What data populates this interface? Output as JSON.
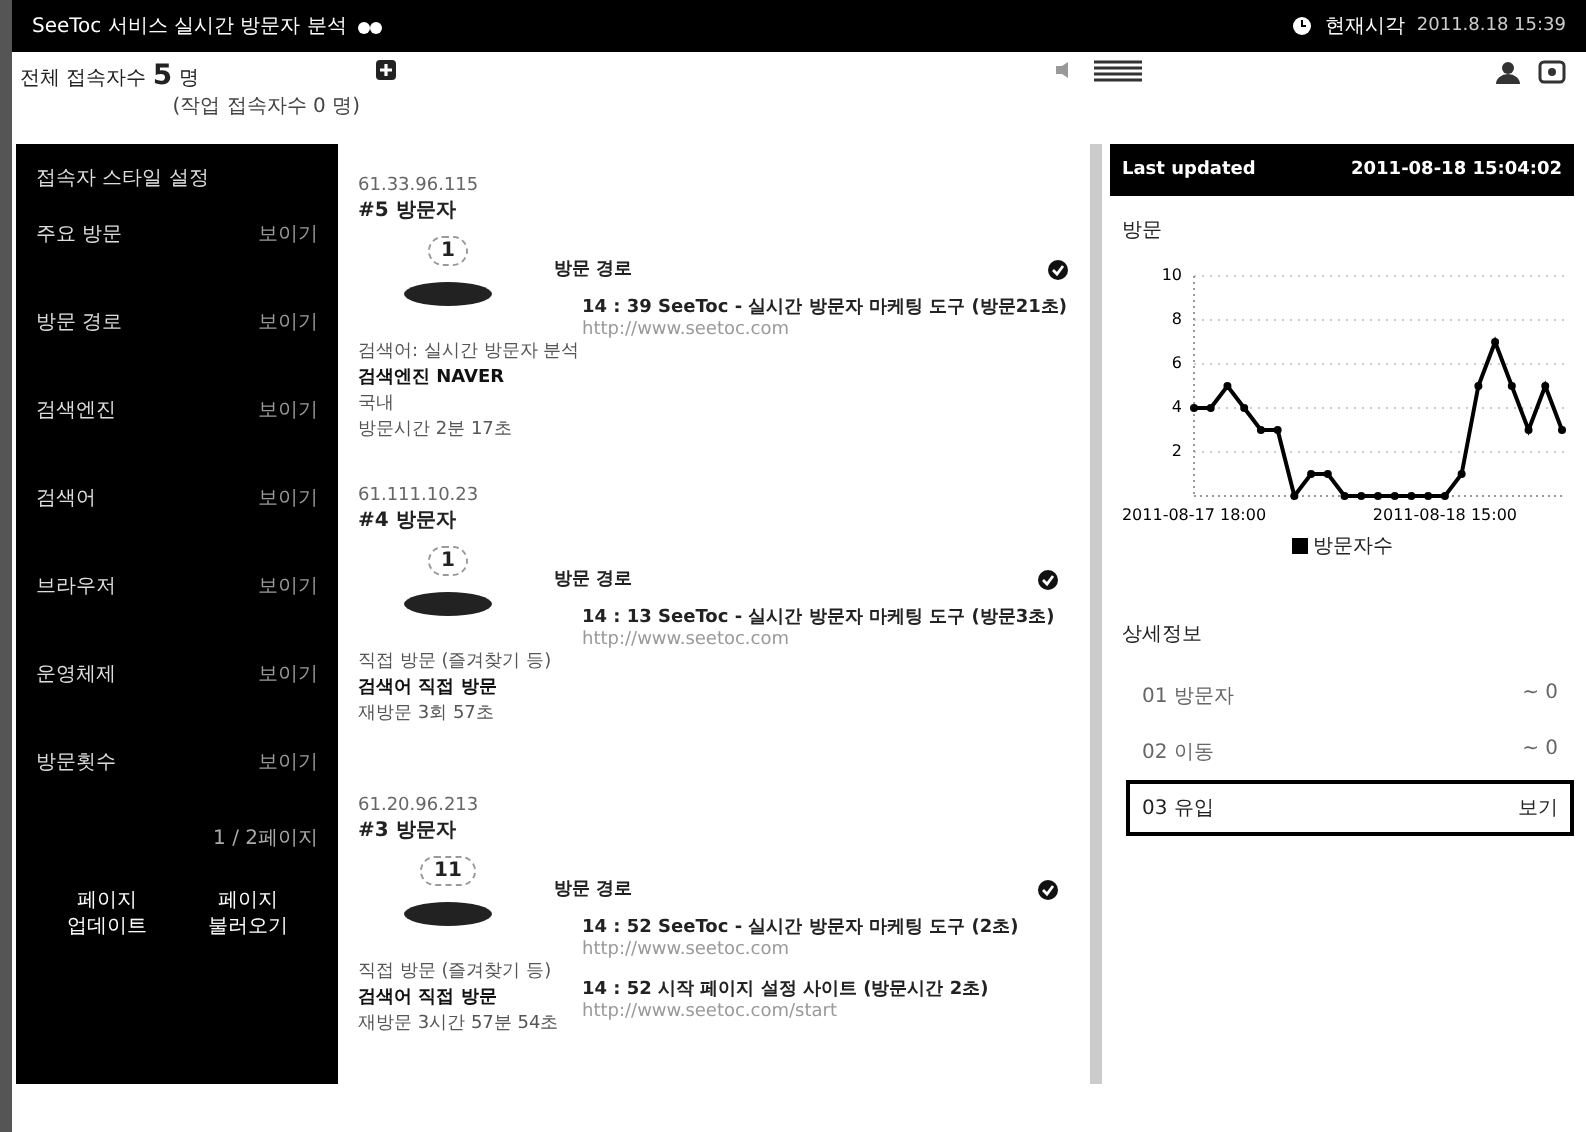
{
  "window": {
    "title": "SeeToc 서비스 실시간 방문자 분석",
    "clock_label": "현재시각",
    "clock": "2011.8.18 15:39"
  },
  "summary": {
    "total_label": "전체 접속자수",
    "total": "5",
    "unit": "명",
    "sub": "(작업 접속자수 0 명)"
  },
  "sidebar": {
    "title": "접속자 스타일 설정",
    "items": [
      {
        "label": "주요 방문",
        "value": "보이기"
      },
      {
        "label": "방문 경로",
        "value": "보이기"
      },
      {
        "label": "검색엔진",
        "value": "보이기"
      },
      {
        "label": "검색어",
        "value": "보이기"
      },
      {
        "label": "브라우저",
        "value": "보이기"
      },
      {
        "label": "운영체제",
        "value": "보이기"
      },
      {
        "label": "방문횟수",
        "value": "보이기"
      }
    ],
    "page": "1 / 2페이지",
    "buttons": [
      {
        "line1": "페이지",
        "line2": "업데이트"
      },
      {
        "line1": "페이지",
        "line2": "불러오기"
      }
    ]
  },
  "visitors": [
    {
      "ip": "61.33.96.115",
      "name": "#5 방문자",
      "count": "1",
      "details": [
        "검색어: 실시간 방문자 분석",
        "검색엔진 NAVER",
        "국내",
        "방문시간 2분 17초"
      ],
      "path_label": "방문 경로",
      "pages": [
        {
          "title": "14 : 39 SeeToc - 실시간 방문자 마케팅 도구 (방문21초)",
          "url": "http://www.seetoc.com"
        }
      ]
    },
    {
      "ip": "61.111.10.23",
      "name": "#4 방문자",
      "count": "1",
      "details": [
        "직접 방문 (즐겨찾기 등)",
        "검색어 직접 방문",
        "재방문 3회 57초"
      ],
      "path_label": "방문 경로",
      "pages": [
        {
          "title": "14 : 13 SeeToc - 실시간 방문자 마케팅 도구 (방문3초)",
          "url": "http://www.seetoc.com"
        }
      ]
    },
    {
      "ip": "61.20.96.213",
      "name": "#3 방문자",
      "count": "11",
      "details": [
        "직접 방문 (즐겨찾기 등)",
        "검색어 직접 방문",
        "재방문 3시간 57분 54초"
      ],
      "path_label": "방문 경로",
      "pages": [
        {
          "title": "14 : 52 SeeToc - 실시간 방문자 마케팅 도구 (2초)",
          "url": "http://www.seetoc.com"
        },
        {
          "title": "14 : 52 시작 페이지 설정 사이트 (방문시간 2초)",
          "url": "http://www.seetoc.com/start"
        }
      ]
    }
  ],
  "panel": {
    "title": "Last updated",
    "updated": "2011-08-18 15:04:02",
    "chart_data": {
      "type": "line",
      "ylabel": "방문",
      "yticks": [
        2,
        4,
        6,
        8,
        10
      ],
      "ylim": [
        0,
        10
      ],
      "grid": true,
      "categories": [
        "2011-08-17 18:00",
        null,
        null,
        null,
        null,
        null,
        null,
        null,
        null,
        null,
        null,
        null,
        null,
        null,
        null,
        "2011-08-18 15:00",
        null,
        null,
        null,
        null,
        null,
        null,
        null
      ],
      "series": [
        {
          "name": "방문자수",
          "color": "#000000",
          "marker": "circle",
          "values": [
            4,
            4,
            5,
            4,
            3,
            3,
            0,
            1,
            1,
            0,
            0,
            0,
            0,
            0,
            0,
            0,
            1,
            5,
            7,
            5,
            3,
            5,
            3
          ]
        }
      ]
    },
    "detail_title": "상세정보",
    "details": [
      {
        "label": "01 방문자",
        "value": "~ 0",
        "selected": false
      },
      {
        "label": "02 이동",
        "value": "~ 0",
        "selected": false
      },
      {
        "label": "03 유입",
        "value": "보기",
        "selected": true
      }
    ]
  }
}
